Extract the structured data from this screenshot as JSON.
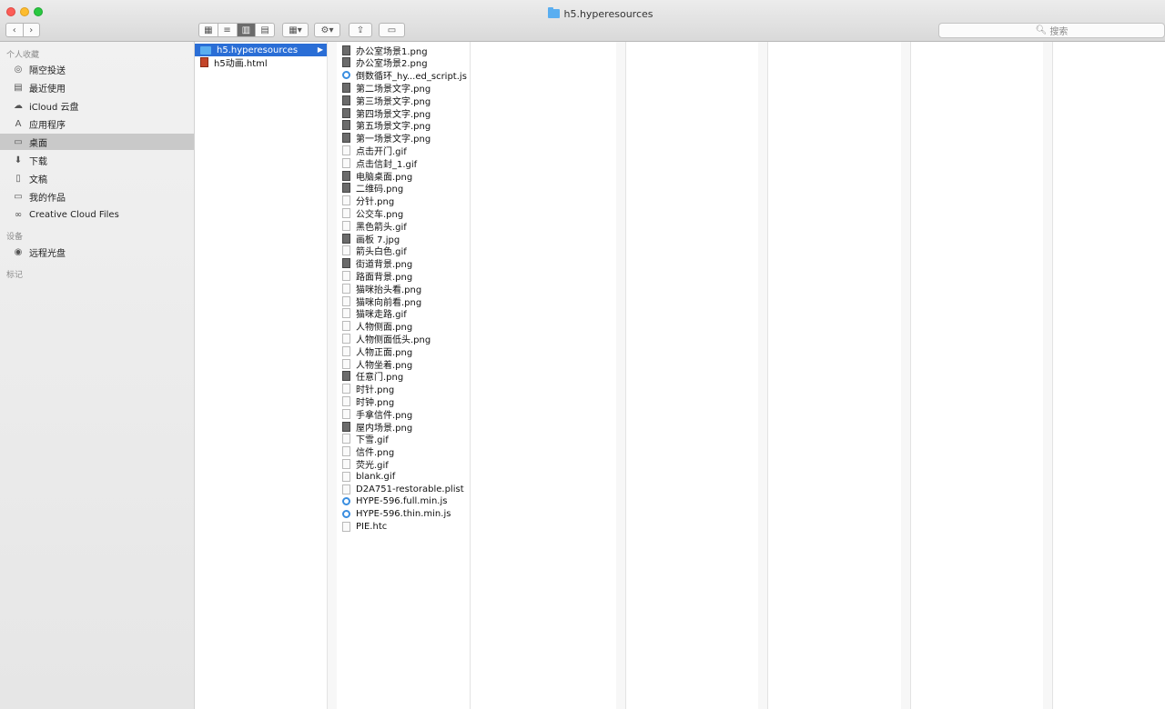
{
  "window": {
    "title": "h5.hyperesources"
  },
  "toolbar": {
    "back": "‹",
    "forward": "›",
    "views": [
      "▦",
      "≡",
      "▥",
      "▤"
    ],
    "arrange": "▦▾",
    "action": "⚙▾",
    "share": "⇪",
    "tag": "▭",
    "search_placeholder": "搜索",
    "search_icon": "🔍︎"
  },
  "sidebar": {
    "favorites_header": "个人收藏",
    "favorites": [
      {
        "label": "隔空投送",
        "icon": "◎"
      },
      {
        "label": "最近使用",
        "icon": "▤"
      },
      {
        "label": "iCloud 云盘",
        "icon": "☁"
      },
      {
        "label": "应用程序",
        "icon": "A"
      },
      {
        "label": "桌面",
        "icon": "▭"
      },
      {
        "label": "下载",
        "icon": "⬇"
      },
      {
        "label": "文稿",
        "icon": "▯"
      },
      {
        "label": "我的作品",
        "icon": "▭"
      },
      {
        "label": "Creative Cloud Files",
        "icon": "∞"
      }
    ],
    "devices_header": "设备",
    "devices": [
      {
        "label": "远程光盘",
        "icon": "◉"
      }
    ],
    "tags_header": "标记"
  },
  "column1": [
    {
      "name": "h5.hyperesources",
      "type": "folder"
    },
    {
      "name": "h5动画.html",
      "type": "html"
    }
  ],
  "column2": [
    {
      "name": "办公室场景1.png",
      "type": "img"
    },
    {
      "name": "办公室场景2.png",
      "type": "img"
    },
    {
      "name": "倒数循环_hy...ed_script.js",
      "type": "js"
    },
    {
      "name": "第二场景文字.png",
      "type": "img"
    },
    {
      "name": "第三场景文字.png",
      "type": "img"
    },
    {
      "name": "第四场景文字.png",
      "type": "img"
    },
    {
      "name": "第五场景文字.png",
      "type": "img"
    },
    {
      "name": "第一场景文字.png",
      "type": "img"
    },
    {
      "name": "点击开门.gif",
      "type": "file"
    },
    {
      "name": "点击信封_1.gif",
      "type": "file"
    },
    {
      "name": "电脑桌面.png",
      "type": "img"
    },
    {
      "name": "二维码.png",
      "type": "img"
    },
    {
      "name": "分针.png",
      "type": "file"
    },
    {
      "name": "公交车.png",
      "type": "file"
    },
    {
      "name": "黑色箭头.gif",
      "type": "file"
    },
    {
      "name": "画板 7.jpg",
      "type": "img"
    },
    {
      "name": "箭头白色.gif",
      "type": "file"
    },
    {
      "name": "街道背景.png",
      "type": "img"
    },
    {
      "name": "路面背景.png",
      "type": "file"
    },
    {
      "name": "猫咪抬头看.png",
      "type": "file"
    },
    {
      "name": "猫咪向前看.png",
      "type": "file"
    },
    {
      "name": "猫咪走路.gif",
      "type": "file"
    },
    {
      "name": "人物侧面.png",
      "type": "file"
    },
    {
      "name": "人物侧面低头.png",
      "type": "file"
    },
    {
      "name": "人物正面.png",
      "type": "file"
    },
    {
      "name": "人物坐着.png",
      "type": "file"
    },
    {
      "name": "任意门.png",
      "type": "img"
    },
    {
      "name": "时针.png",
      "type": "file"
    },
    {
      "name": "时钟.png",
      "type": "file"
    },
    {
      "name": "手拿信件.png",
      "type": "file"
    },
    {
      "name": "屋内场景.png",
      "type": "img"
    },
    {
      "name": "下雪.gif",
      "type": "file"
    },
    {
      "name": "信件.png",
      "type": "file"
    },
    {
      "name": "荧光.gif",
      "type": "file"
    },
    {
      "name": "blank.gif",
      "type": "file"
    },
    {
      "name": "D2A751-restorable.plist",
      "type": "file"
    },
    {
      "name": "HYPE-596.full.min.js",
      "type": "js"
    },
    {
      "name": "HYPE-596.thin.min.js",
      "type": "js"
    },
    {
      "name": "PIE.htc",
      "type": "file"
    }
  ],
  "colors": {
    "selection": "#2a6ed6",
    "sidebar_selected": "#c9c9c9"
  }
}
